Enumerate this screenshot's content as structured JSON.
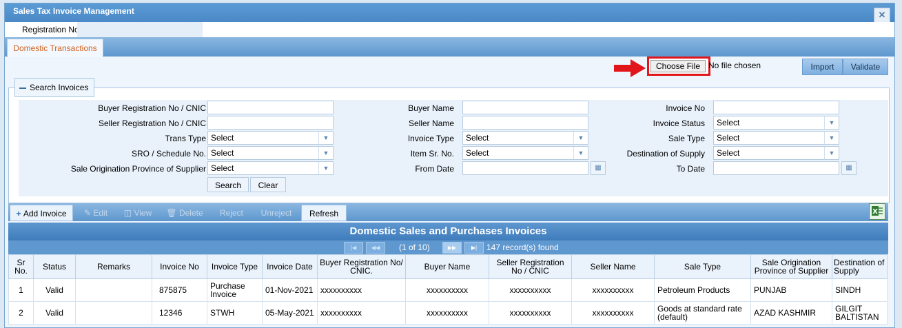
{
  "window": {
    "title": "Sales Tax Invoice Management",
    "close_icon": "close-icon"
  },
  "registration": {
    "label": "Registration No",
    "value": ""
  },
  "tabs": [
    {
      "label": "Domestic Transactions",
      "active": true
    }
  ],
  "file": {
    "choose_label": "Choose File",
    "status": "No file chosen",
    "import_label": "Import",
    "validate_label": "Validate"
  },
  "search": {
    "legend": "Search Invoices",
    "col1": {
      "buyer_reg_label": "Buyer Registration No / CNIC",
      "seller_reg_label": "Seller Registration No / CNIC",
      "trans_type_label": "Trans Type",
      "trans_type_value": "Select",
      "sro_label": "SRO / Schedule No.",
      "sro_value": "Select",
      "origin_label": "Sale Origination Province of Supplier",
      "origin_value": "Select"
    },
    "col2": {
      "buyer_name_label": "Buyer Name",
      "seller_name_label": "Seller Name",
      "invoice_type_label": "Invoice Type",
      "invoice_type_value": "Select",
      "item_sr_label": "Item Sr. No.",
      "item_sr_value": "Select",
      "from_date_label": "From Date"
    },
    "col3": {
      "invoice_no_label": "Invoice No",
      "invoice_status_label": "Invoice Status",
      "invoice_status_value": "Select",
      "sale_type_label": "Sale Type",
      "sale_type_value": "Select",
      "destination_label": "Destination of Supply",
      "destination_value": "Select",
      "to_date_label": "To Date"
    },
    "search_btn": "Search",
    "clear_btn": "Clear"
  },
  "grid_toolbar": {
    "add": "Add Invoice",
    "edit": "Edit",
    "view": "View",
    "delete": "Delete",
    "reject": "Reject",
    "unreject": "Unreject",
    "refresh": "Refresh"
  },
  "grid": {
    "title": "Domestic Sales and Purchases Invoices",
    "page_info": "(1 of 10)",
    "records": "147 record(s) found",
    "columns": [
      "Sr No.",
      "Status",
      "Remarks",
      "Invoice No",
      "Invoice Type",
      "Invoice Date",
      "Buyer Registration No/ CNIC.",
      "Buyer Name",
      "Seller Registration No / CNIC",
      "Seller Name",
      "Sale Type",
      "Sale Origination Province of Supplier",
      "Destination of Supply"
    ],
    "rows": [
      [
        "1",
        "Valid",
        "",
        "875875",
        "Purchase Invoice",
        "01-Nov-2021",
        "xxxxxxxxxx",
        "xxxxxxxxxx",
        "xxxxxxxxxx",
        "xxxxxxxxxx",
        "Petroleum Products",
        "PUNJAB",
        "SINDH"
      ],
      [
        "2",
        "Valid",
        "",
        "12346",
        "STWH",
        "05-May-2021",
        "xxxxxxxxxx",
        "xxxxxxxxxx",
        "xxxxxxxxxx",
        "xxxxxxxxxx",
        "Goods at standard rate (default)",
        "AZAD KASHMIR",
        "GILGIT BALTISTAN"
      ]
    ]
  },
  "colors": {
    "accent": "#5e97cf",
    "tab_text": "#d0601c",
    "highlight": "#e0161b"
  }
}
